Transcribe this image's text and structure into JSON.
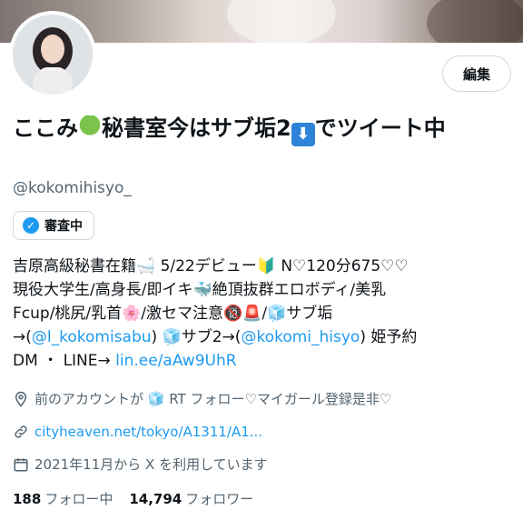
{
  "profile": {
    "display_name_part1": "ここみ",
    "display_name_part2": "秘書室今はサブ垢2",
    "display_name_part3": "でツイート中",
    "handle": "@kokomihisyo_",
    "edit_label": "編集",
    "verification_label": "審査中"
  },
  "bio": {
    "line1": "吉原高級秘書在籍🛁 5/22デビュー🔰 N♡120分675♡♡",
    "line2": "現役大学生/高身長/即イキ🐳絶頂抜群エロボディ/美乳",
    "line3": "Fcup/桃尻/乳首🌸/激セマ注意🔞🚨/🧊サブ垢",
    "line4_prefix": "→(",
    "line4_link1": "@l_kokomisabu",
    "line4_mid": ") 🧊サブ2→(",
    "line4_link2": "@kokomi_hisyo",
    "line4_suffix": ") 姫予約",
    "line5_prefix": "DM ・ LINE→ ",
    "line5_link": "lin.ee/aAw9UhR"
  },
  "meta": {
    "location": "前のアカウントが 🧊 RT フォロー♡マイガール登録是非♡",
    "website": "cityheaven.net/tokyo/A1311/A1...",
    "joined": "2021年11月から X を利用しています"
  },
  "stats": {
    "following_count": "188",
    "following_label": "フォロー中",
    "followers_count": "14,794",
    "followers_label": "フォロワー"
  },
  "icons": {
    "location": "location-pin-icon",
    "link": "link-icon",
    "calendar": "calendar-icon",
    "verify": "verified-badge-icon"
  },
  "colors": {
    "accent": "#1d9bf0",
    "secondary_text": "#536471",
    "primary_text": "#0f1419"
  }
}
